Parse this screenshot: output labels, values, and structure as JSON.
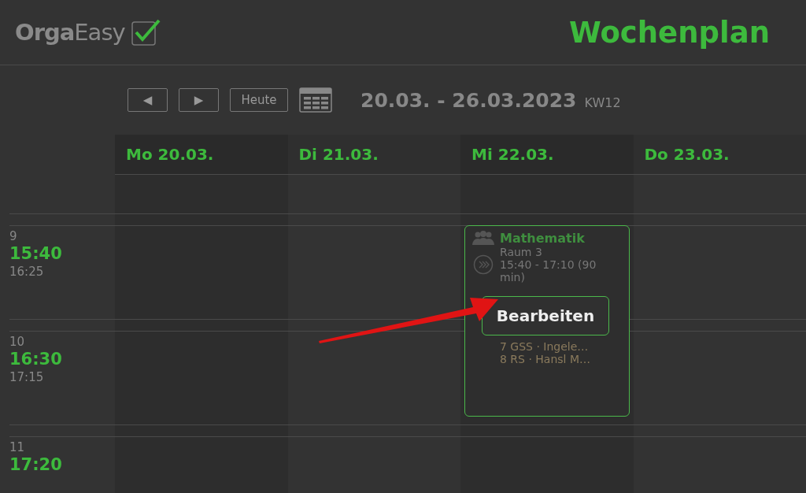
{
  "header": {
    "logo_bold": "Orga",
    "logo_light": "Easy",
    "title": "Wochenplan"
  },
  "toolbar": {
    "prev": "◀",
    "next": "▶",
    "today": "Heute",
    "range": "20.03. - 26.03.2023",
    "week": "KW12"
  },
  "days": [
    {
      "label": "Mo 20.03."
    },
    {
      "label": "Di 21.03."
    },
    {
      "label": "Mi 22.03.",
      "event": {
        "subject": "Mathematik",
        "room": "Raum 3",
        "time": "15:40 - 17:10  (90 min)",
        "classes": [
          "7 GSS · Ingele…",
          "8 RS · Hansl M…"
        ],
        "action": "Bearbeiten"
      }
    },
    {
      "label": "Do 23.03."
    }
  ],
  "slots": [
    {
      "number": "9",
      "start": "15:40",
      "end": "16:25"
    },
    {
      "number": "10",
      "start": "16:30",
      "end": "17:15"
    },
    {
      "number": "11",
      "start": "17:20"
    }
  ]
}
